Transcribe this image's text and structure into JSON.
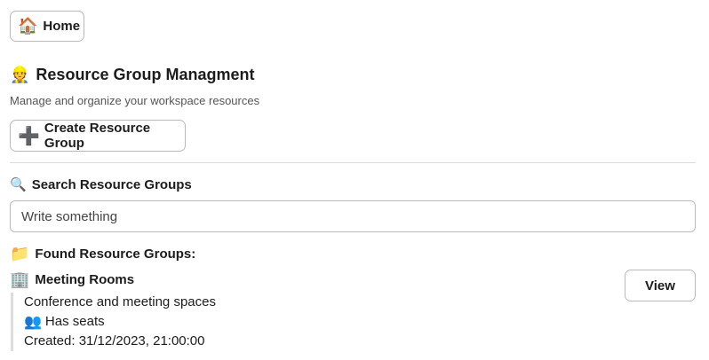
{
  "nav": {
    "home_icon": "house-icon",
    "home_label": "Home"
  },
  "header": {
    "title_icon": "construction-worker-icon",
    "title": "Resource Group Managment",
    "subtitle": "Manage and organize your workspace resources"
  },
  "actions": {
    "create_icon": "plus-icon",
    "create_label": "Create Resource Group"
  },
  "search": {
    "label_icon": "magnifier-icon",
    "label": "Search Resource Groups",
    "placeholder": "Write something",
    "value": ""
  },
  "results": {
    "label_icon": "folder-icon",
    "label": "Found Resource Groups:",
    "groups": [
      {
        "icon": "office-building-icon",
        "name": "Meeting Rooms",
        "description": "Conference and meeting spaces",
        "seats_icon": "people-icon",
        "seats_text": "Has seats",
        "created": "Created: 31/12/2023, 21:00:00",
        "view_label": "View"
      }
    ]
  }
}
